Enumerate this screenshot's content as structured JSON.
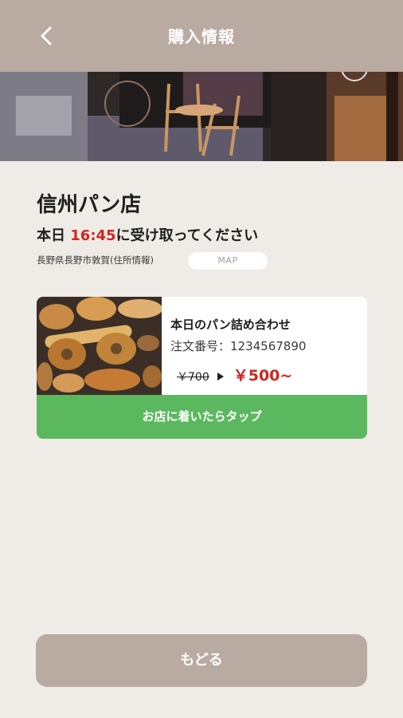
{
  "header": {
    "title": "購入情報",
    "back_icon": "chevron-left-icon"
  },
  "shop": {
    "name": "信州パン店",
    "pickup_prefix": "本日 ",
    "pickup_time": "16:45",
    "pickup_suffix": "に受け取ってください",
    "address": "長野県長野市敦賀(住所情報)",
    "map_label": "MAP"
  },
  "order": {
    "product_name": "本日のパン詰め合わせ",
    "order_number_line": "注文番号：1234567890",
    "old_price": "￥700",
    "new_price": "￥500~",
    "arrive_button": "お店に着いたらタップ"
  },
  "footer": {
    "back_label": "もどる"
  },
  "colors": {
    "accent": "#b9aaa2",
    "price_red": "#d0261e",
    "green": "#5cb85f",
    "background": "#efebe6"
  }
}
